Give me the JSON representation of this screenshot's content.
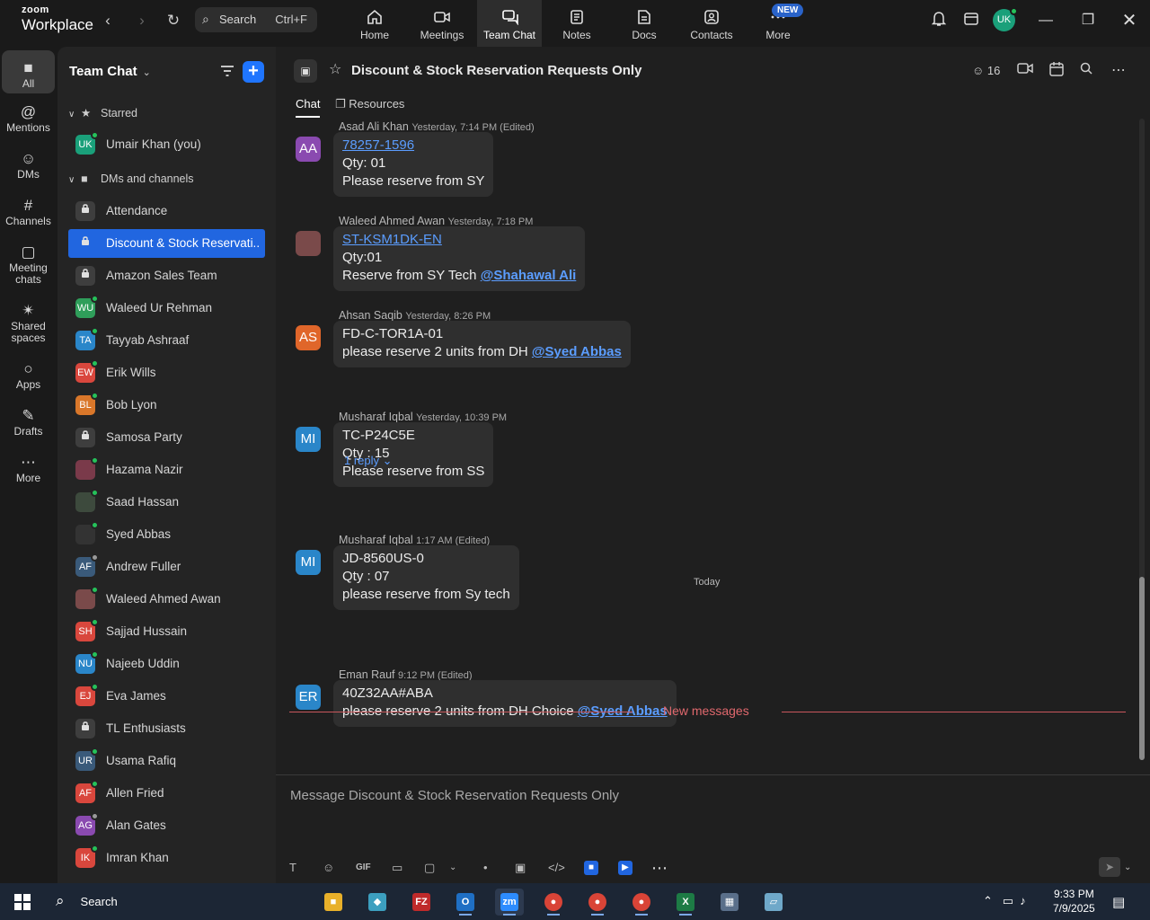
{
  "app": {
    "logo_top": "zoom",
    "logo_bottom": "Workplace"
  },
  "search": {
    "label": "Search",
    "shortcut": "Ctrl+F"
  },
  "nav": [
    {
      "label": "Home"
    },
    {
      "label": "Meetings"
    },
    {
      "label": "Team Chat"
    },
    {
      "label": "Notes"
    },
    {
      "label": "Docs"
    },
    {
      "label": "Contacts"
    },
    {
      "label": "More"
    }
  ],
  "new_badge": "NEW",
  "user_avatar": "UK",
  "rail": [
    {
      "label": "All",
      "icon": "chat-bubble-icon"
    },
    {
      "label": "Mentions",
      "icon": "at-icon"
    },
    {
      "label": "DMs",
      "icon": "people-icon"
    },
    {
      "label": "Channels",
      "icon": "hash-icon"
    },
    {
      "label": "Meeting chats",
      "icon": "calendar-icon"
    },
    {
      "label": "Shared spaces",
      "icon": "share-icon"
    },
    {
      "label": "Apps",
      "icon": "apps-icon"
    },
    {
      "label": "Drafts",
      "icon": "draft-icon"
    },
    {
      "label": "More",
      "icon": "more-icon"
    }
  ],
  "sidebar": {
    "title": "Team Chat",
    "starred_label": "Starred",
    "dms_label": "DMs and channels",
    "starred": [
      {
        "name": "Umair Khan (you)",
        "initials": "UK",
        "color": "#1aa07a",
        "status": "#25c25a"
      }
    ],
    "items": [
      {
        "name": "Attendance",
        "type": "lock"
      },
      {
        "name": "Discount & Stock Reservati...",
        "type": "lock",
        "selected": true
      },
      {
        "name": "Amazon Sales Team",
        "type": "lock"
      },
      {
        "name": "Waleed Ur Rehman",
        "initials": "WU",
        "color": "#2f9e5a",
        "status": "#25c25a"
      },
      {
        "name": "Tayyab Ashraaf",
        "initials": "TA",
        "color": "#2a86c9",
        "status": "#25c25a"
      },
      {
        "name": "Erik Wills",
        "initials": "EW",
        "color": "#d9473d",
        "status": "#25c25a"
      },
      {
        "name": "Bob Lyon",
        "initials": "BL",
        "color": "#d9772a",
        "status": "#25c25a"
      },
      {
        "name": "Samosa Party",
        "type": "lock"
      },
      {
        "name": "Hazama Nazir",
        "initials": "",
        "color": "#7a3a4a",
        "status": "#25c25a"
      },
      {
        "name": "Saad Hassan",
        "initials": "",
        "color": "#3d4a3d",
        "status": "#25c25a"
      },
      {
        "name": "Syed Abbas",
        "initials": "",
        "color": "#333333",
        "status": "#25c25a"
      },
      {
        "name": "Andrew Fuller",
        "initials": "AF",
        "color": "#3a5a7a",
        "status": "#999999"
      },
      {
        "name": "Waleed Ahmed Awan",
        "initials": "",
        "color": "#7a4a4a",
        "status": "#25c25a"
      },
      {
        "name": "Sajjad Hussain",
        "initials": "SH",
        "color": "#d9473d",
        "status": "#25c25a"
      },
      {
        "name": "Najeeb Uddin",
        "initials": "NU",
        "color": "#2a86c9",
        "status": "#25c25a"
      },
      {
        "name": "Eva James",
        "initials": "EJ",
        "color": "#d9473d",
        "status": "#25c25a"
      },
      {
        "name": "TL Enthusiasts",
        "type": "lock"
      },
      {
        "name": "Usama Rafiq",
        "initials": "UR",
        "color": "#3a5a7a",
        "status": "#25c25a"
      },
      {
        "name": "Allen Fried",
        "initials": "AF",
        "color": "#d9473d",
        "status": "#25c25a"
      },
      {
        "name": "Alan Gates",
        "initials": "AG",
        "color": "#8a4ab0",
        "status": "#999999"
      },
      {
        "name": "Imran Khan",
        "initials": "IK",
        "color": "#d9473d",
        "status": "#25c25a"
      }
    ]
  },
  "channel": {
    "title": "Discount & Stock Reservation Requests Only",
    "members": "16",
    "tabs": {
      "chat": "Chat",
      "resources": "Resources"
    }
  },
  "messages": [
    {
      "sender": "Asad Ali Khan",
      "time": "Yesterday, 7:14 PM (Edited)",
      "initials": "AA",
      "color": "#8a4ab0",
      "lines": [
        "78257-1596",
        "Qty: 01",
        "Please reserve from SY"
      ]
    },
    {
      "sender": "Waleed Ahmed Awan",
      "time": "Yesterday, 7:18 PM",
      "initials": "",
      "color": "#7a4a4a",
      "lines": [
        "ST-KSM1DK-EN",
        "Qty:01",
        "Reserve from SY Tech ",
        "@Shahawal Ali"
      ]
    },
    {
      "sender": "Ahsan Saqib",
      "time": "Yesterday, 8:26 PM",
      "initials": "AS",
      "color": "#e0662a",
      "lines": [
        "FD-C-TOR1A-01",
        "please reserve 2 units from DH ",
        "@Syed Abbas"
      ],
      "reply": "1 reply"
    },
    {
      "sender": "Musharaf Iqbal",
      "time": "Yesterday, 10:39 PM",
      "initials": "MI",
      "color": "#2a86c9",
      "lines": [
        "TC-P24C5E",
        "Qty : 15",
        "Please reserve from SS"
      ]
    },
    {
      "sender": "Musharaf Iqbal",
      "time": "1:17 AM (Edited)",
      "initials": "MI",
      "color": "#2a86c9",
      "lines": [
        "JD-8560US-0",
        "Qty : 07",
        "please reserve from Sy tech"
      ]
    },
    {
      "sender": "Eman Rauf",
      "time": "9:12 PM (Edited)",
      "initials": "ER",
      "color": "#2a86c9",
      "lines": [
        "40Z32AA#ABA",
        "please reserve 2 units from DH Choice ",
        "@Syed Abbas"
      ]
    }
  ],
  "separators": {
    "today": "Today",
    "new_messages": "New messages"
  },
  "composer": {
    "placeholder": "Message Discount & Stock Reservation Requests Only",
    "gif": "GIF"
  },
  "taskbar": {
    "search": "Search",
    "time": "9:33 PM",
    "date": "7/9/2025"
  }
}
